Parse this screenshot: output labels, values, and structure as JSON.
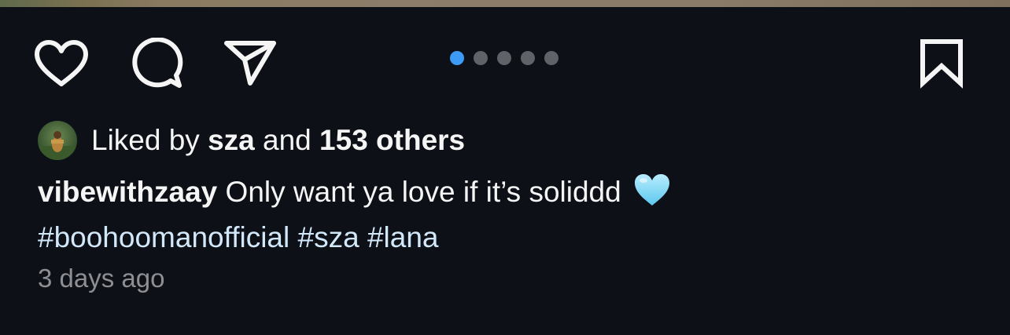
{
  "post": {
    "actions": {
      "like_icon": "heart-outline-icon",
      "comment_icon": "speech-bubble-icon",
      "share_icon": "paper-plane-icon",
      "save_icon": "bookmark-outline-icon"
    },
    "carousel": {
      "total": 5,
      "active_index": 0,
      "active_color": "#3d9bf5",
      "inactive_color": "#5f6368"
    },
    "likes": {
      "prefix": "Liked by",
      "user": "sza",
      "connector": "and",
      "others": "153 others"
    },
    "caption": {
      "username": "vibewithzaay",
      "text": "Only want ya love if it’s soliddd",
      "emoji": "light-blue-heart-icon",
      "hashtags": [
        "#boohoomanofficial",
        "#sza",
        "#lana"
      ]
    },
    "timestamp": "3 days ago"
  },
  "colors": {
    "background": "#0d1117",
    "text": "#f5f5f5",
    "hashtag": "#d2e8fa",
    "timestamp": "#8e8e93"
  }
}
